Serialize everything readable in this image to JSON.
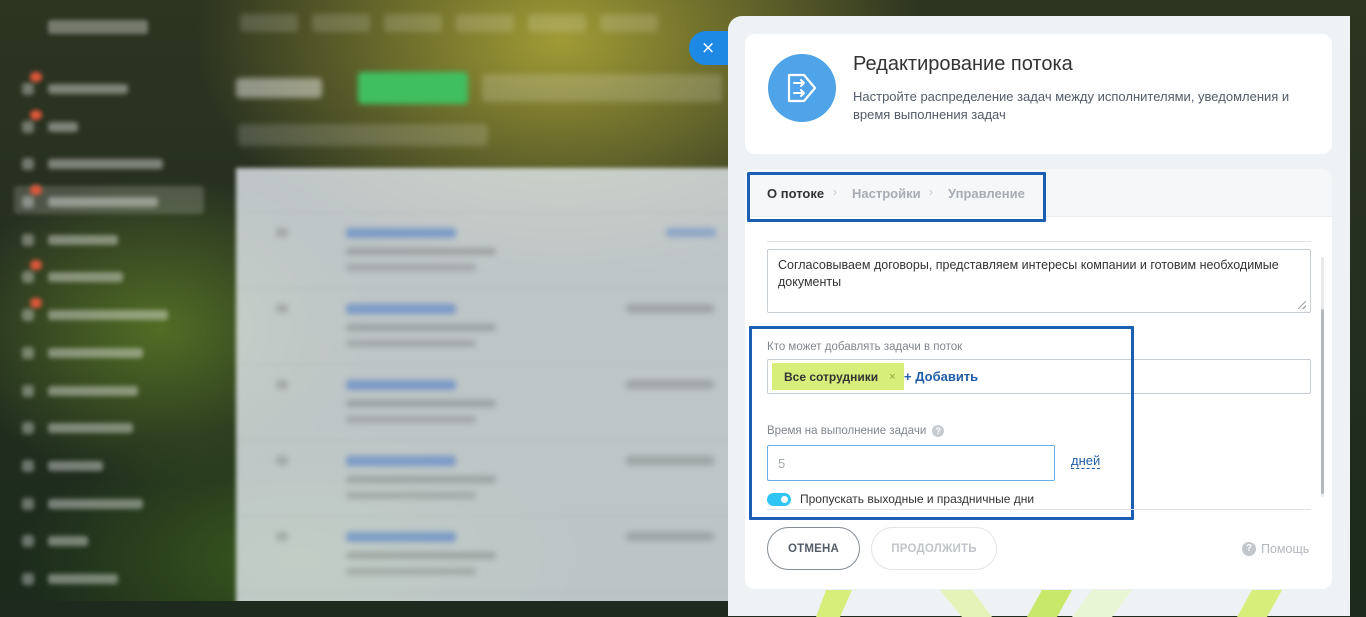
{
  "close_button": {
    "icon": "close-icon",
    "glyph": "×"
  },
  "header": {
    "icon": "flow-icon",
    "title": "Редактирование потока",
    "description": "Настройте распределение задач между исполнителями, уведомления и время выполнения задач"
  },
  "tabs": [
    {
      "label": "О потоке",
      "active": true
    },
    {
      "label": "Настройки",
      "active": false
    },
    {
      "label": "Управление",
      "active": false
    }
  ],
  "tab_separator": "›",
  "form": {
    "description_value": "Согласовываем договоры, представляем интересы компании и готовим необходимые документы",
    "who_can_add_label": "Кто может добавлять задачи в поток",
    "who_can_add_chip": "Все сотрудники",
    "chip_remove_glyph": "×",
    "add_link": "+ Добавить",
    "time_label": "Время на выполнение задачи",
    "time_help_glyph": "?",
    "time_value": "5",
    "time_unit": "дней",
    "skip_weekends_label": "Пропускать выходные и праздничные дни",
    "skip_weekends_on": true
  },
  "buttons": {
    "cancel": "ОТМЕНА",
    "continue": "ПРОДОЛЖИТЬ",
    "help": "Помощь",
    "help_glyph": "?"
  },
  "colors": {
    "accent": "#1e88e5",
    "chip": "#d7ee7b",
    "toggle": "#2fc6f6",
    "highlight": "#1a5fb4",
    "link": "#1f5ea8"
  }
}
